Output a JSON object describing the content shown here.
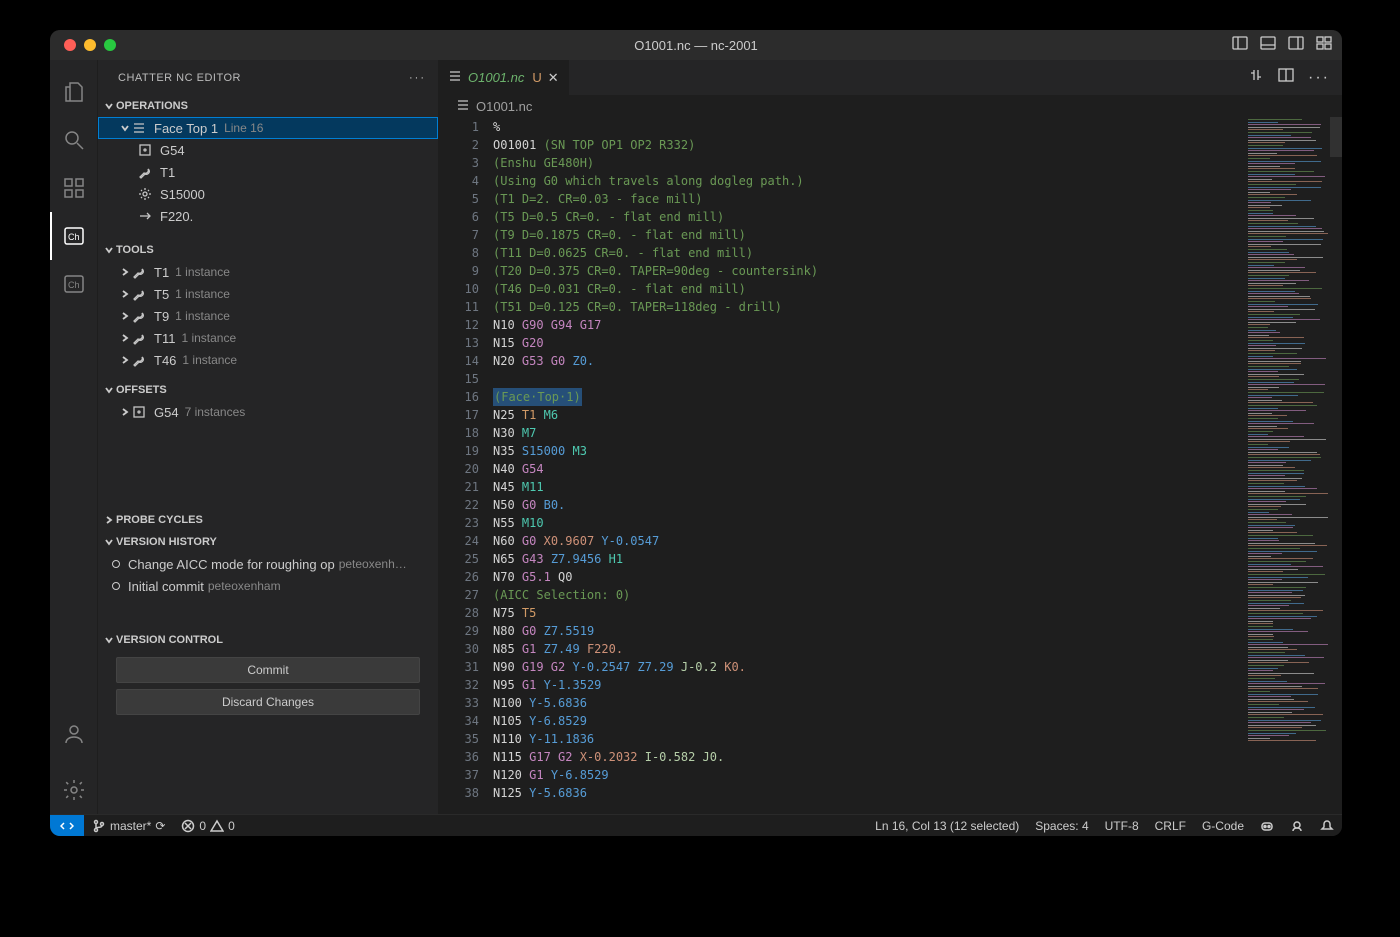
{
  "title": "O1001.nc — nc-2001",
  "sidebar": {
    "title": "CHATTER NC EDITOR",
    "sections": {
      "operations": {
        "label": "OPERATIONS",
        "items": [
          {
            "label": "Face Top 1",
            "meta": "Line 16",
            "children": [
              {
                "label": "G54"
              },
              {
                "label": "T1"
              },
              {
                "label": "S15000"
              },
              {
                "label": "F220."
              }
            ]
          }
        ]
      },
      "tools": {
        "label": "TOOLS",
        "items": [
          {
            "label": "T1",
            "meta": "1 instance"
          },
          {
            "label": "T5",
            "meta": "1 instance"
          },
          {
            "label": "T9",
            "meta": "1 instance"
          },
          {
            "label": "T11",
            "meta": "1 instance"
          },
          {
            "label": "T46",
            "meta": "1 instance"
          }
        ]
      },
      "offsets": {
        "label": "OFFSETS",
        "items": [
          {
            "label": "G54",
            "meta": "7 instances"
          }
        ]
      },
      "probe": {
        "label": "PROBE CYCLES"
      },
      "history": {
        "label": "VERSION HISTORY",
        "items": [
          {
            "msg": "Change AICC mode for roughing op",
            "author": "peteoxenh…"
          },
          {
            "msg": "Initial commit",
            "author": "peteoxenham"
          }
        ]
      },
      "versioncontrol": {
        "label": "VERSION CONTROL",
        "commit": "Commit",
        "discard": "Discard Changes"
      }
    }
  },
  "tab": {
    "filename": "O1001.nc",
    "mod": "U"
  },
  "breadcrumb": "O1001.nc",
  "code_lines": [
    [
      {
        "c": "t-def",
        "t": "%"
      }
    ],
    [
      {
        "c": "t-def",
        "t": "O01001 "
      },
      {
        "c": "t-cmt",
        "t": "(SN TOP OP1 OP2 R332)"
      }
    ],
    [
      {
        "c": "t-cmt",
        "t": "(Enshu GE480H)"
      }
    ],
    [
      {
        "c": "t-cmt",
        "t": "(Using G0 which travels along dogleg path.)"
      }
    ],
    [
      {
        "c": "t-cmt",
        "t": "(T1 D=2. CR=0.03 - face mill)"
      }
    ],
    [
      {
        "c": "t-cmt",
        "t": "(T5 D=0.5 CR=0. - flat end mill)"
      }
    ],
    [
      {
        "c": "t-cmt",
        "t": "(T9 D=0.1875 CR=0. - flat end mill)"
      }
    ],
    [
      {
        "c": "t-cmt",
        "t": "(T11 D=0.0625 CR=0. - flat end mill)"
      }
    ],
    [
      {
        "c": "t-cmt",
        "t": "(T20 D=0.375 CR=0. TAPER=90deg - countersink)"
      }
    ],
    [
      {
        "c": "t-cmt",
        "t": "(T46 D=0.031 CR=0. - flat end mill)"
      }
    ],
    [
      {
        "c": "t-cmt",
        "t": "(T51 D=0.125 CR=0. TAPER=118deg - drill)"
      }
    ],
    [
      {
        "c": "t-def",
        "t": "N10 "
      },
      {
        "c": "t-gw",
        "t": "G90 G94 G17"
      }
    ],
    [
      {
        "c": "t-def",
        "t": "N15 "
      },
      {
        "c": "t-gw",
        "t": "G20"
      }
    ],
    [
      {
        "c": "t-def",
        "t": "N20 "
      },
      {
        "c": "t-gw",
        "t": "G53 G0 "
      },
      {
        "c": "t-num",
        "t": "Z0."
      }
    ],
    [
      {
        "c": "t-def",
        "t": ""
      }
    ],
    [
      {
        "c": "line-hl",
        "t": "",
        "inner": [
          {
            "c": "t-cmt",
            "t": "(Face·Top·1)"
          }
        ]
      }
    ],
    [
      {
        "c": "t-def",
        "t": "N25 "
      },
      {
        "c": "t-t",
        "t": "T1 "
      },
      {
        "c": "t-m",
        "t": "M6"
      }
    ],
    [
      {
        "c": "t-def",
        "t": "N30 "
      },
      {
        "c": "t-m",
        "t": "M7"
      }
    ],
    [
      {
        "c": "t-def",
        "t": "N35 "
      },
      {
        "c": "t-num",
        "t": "S15000 "
      },
      {
        "c": "t-m",
        "t": "M3"
      }
    ],
    [
      {
        "c": "t-def",
        "t": "N40 "
      },
      {
        "c": "t-gw",
        "t": "G54"
      }
    ],
    [
      {
        "c": "t-def",
        "t": "N45 "
      },
      {
        "c": "t-m",
        "t": "M11"
      }
    ],
    [
      {
        "c": "t-def",
        "t": "N50 "
      },
      {
        "c": "t-gw",
        "t": "G0 "
      },
      {
        "c": "t-num",
        "t": "B0."
      }
    ],
    [
      {
        "c": "t-def",
        "t": "N55 "
      },
      {
        "c": "t-m",
        "t": "M10"
      }
    ],
    [
      {
        "c": "t-def",
        "t": "N60 "
      },
      {
        "c": "t-gw",
        "t": "G0 "
      },
      {
        "c": "t-x",
        "t": "X0.9607 "
      },
      {
        "c": "t-num",
        "t": "Y-0.0547"
      }
    ],
    [
      {
        "c": "t-def",
        "t": "N65 "
      },
      {
        "c": "t-gw",
        "t": "G43 "
      },
      {
        "c": "t-num",
        "t": "Z7.9456 "
      },
      {
        "c": "t-m",
        "t": "H1"
      }
    ],
    [
      {
        "c": "t-def",
        "t": "N70 "
      },
      {
        "c": "t-gw",
        "t": "G5.1 "
      },
      {
        "c": "t-def",
        "t": "Q0"
      }
    ],
    [
      {
        "c": "t-cmt",
        "t": "(AICC Selection: 0)"
      }
    ],
    [
      {
        "c": "t-def",
        "t": "N75 "
      },
      {
        "c": "t-t",
        "t": "T5"
      }
    ],
    [
      {
        "c": "t-def",
        "t": "N80 "
      },
      {
        "c": "t-gw",
        "t": "G0 "
      },
      {
        "c": "t-num",
        "t": "Z7.5519"
      }
    ],
    [
      {
        "c": "t-def",
        "t": "N85 "
      },
      {
        "c": "t-gw",
        "t": "G1 "
      },
      {
        "c": "t-num",
        "t": "Z7.49 "
      },
      {
        "c": "t-f",
        "t": "F220."
      }
    ],
    [
      {
        "c": "t-def",
        "t": "N90 "
      },
      {
        "c": "t-gw",
        "t": "G19 G2 "
      },
      {
        "c": "t-num",
        "t": "Y-0.2547 Z7.29 "
      },
      {
        "c": "t-j",
        "t": "J-0.2 "
      },
      {
        "c": "t-f",
        "t": "K0."
      }
    ],
    [
      {
        "c": "t-def",
        "t": "N95 "
      },
      {
        "c": "t-gw",
        "t": "G1 "
      },
      {
        "c": "t-num",
        "t": "Y-1.3529"
      }
    ],
    [
      {
        "c": "t-def",
        "t": "N100 "
      },
      {
        "c": "t-num",
        "t": "Y-5.6836"
      }
    ],
    [
      {
        "c": "t-def",
        "t": "N105 "
      },
      {
        "c": "t-num",
        "t": "Y-6.8529"
      }
    ],
    [
      {
        "c": "t-def",
        "t": "N110 "
      },
      {
        "c": "t-num",
        "t": "Y-11.1836"
      }
    ],
    [
      {
        "c": "t-def",
        "t": "N115 "
      },
      {
        "c": "t-gw",
        "t": "G17 G2 "
      },
      {
        "c": "t-x",
        "t": "X-0.2032 "
      },
      {
        "c": "t-j",
        "t": "I-0.582 J0."
      }
    ],
    [
      {
        "c": "t-def",
        "t": "N120 "
      },
      {
        "c": "t-gw",
        "t": "G1 "
      },
      {
        "c": "t-num",
        "t": "Y-6.8529"
      }
    ],
    [
      {
        "c": "t-def",
        "t": "N125 "
      },
      {
        "c": "t-num",
        "t": "Y-5.6836"
      }
    ]
  ],
  "status": {
    "branch": "master*",
    "sync": "⟳",
    "errors": "0",
    "warnings": "0",
    "lncol": "Ln 16, Col 13 (12 selected)",
    "spaces": "Spaces: 4",
    "encoding": "UTF-8",
    "eol": "CRLF",
    "lang": "G-Code"
  }
}
